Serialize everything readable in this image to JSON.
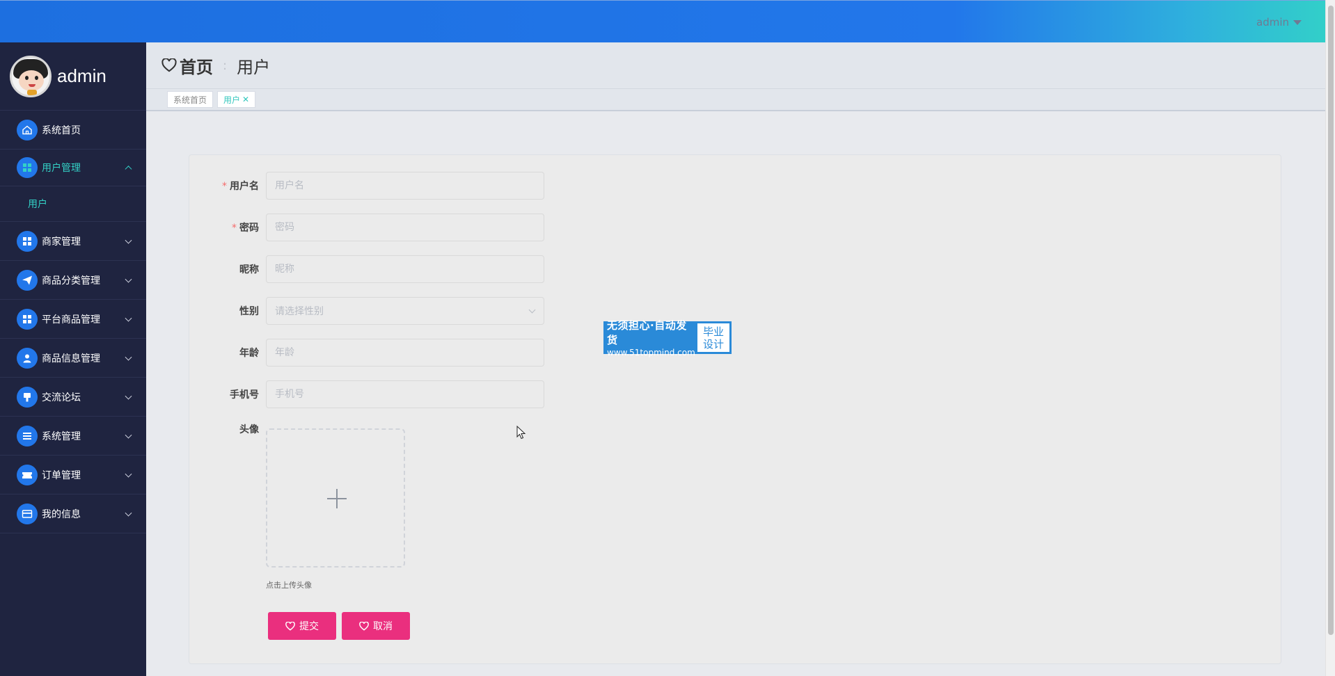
{
  "topbar": {
    "user": "admin"
  },
  "sidebar": {
    "profile_name": "admin",
    "items": [
      {
        "label": "系统首页",
        "icon": "home-icon"
      },
      {
        "label": "用户管理",
        "icon": "grid-icon",
        "open": true,
        "children": [
          {
            "label": "用户"
          }
        ]
      },
      {
        "label": "商家管理",
        "icon": "grid-icon"
      },
      {
        "label": "商品分类管理",
        "icon": "send-icon"
      },
      {
        "label": "平台商品管理",
        "icon": "grid-icon"
      },
      {
        "label": "商品信息管理",
        "icon": "user-icon"
      },
      {
        "label": "交流论坛",
        "icon": "brush-icon"
      },
      {
        "label": "系统管理",
        "icon": "list-icon"
      },
      {
        "label": "订单管理",
        "icon": "ticket-icon"
      },
      {
        "label": "我的信息",
        "icon": "card-icon"
      }
    ]
  },
  "breadcrumb": {
    "home": "首页",
    "current": "用户"
  },
  "tags": [
    {
      "label": "系统首页"
    },
    {
      "label": "用户",
      "closable": true
    }
  ],
  "form": {
    "username": {
      "label": "用户名",
      "placeholder": "用户名",
      "required": true
    },
    "password": {
      "label": "密码",
      "placeholder": "密码",
      "required": true
    },
    "nickname": {
      "label": "昵称",
      "placeholder": "昵称"
    },
    "gender": {
      "label": "性别",
      "placeholder": "请选择性别"
    },
    "age": {
      "label": "年龄",
      "placeholder": "年龄"
    },
    "phone": {
      "label": "手机号",
      "placeholder": "手机号"
    },
    "avatar": {
      "label": "头像",
      "tip": "点击上传头像"
    },
    "submit_label": "提交",
    "cancel_label": "取消"
  },
  "watermark": {
    "line1": "无须担心·自动发货",
    "line2": "www.51topmind.com",
    "right_line1": "毕业",
    "right_line2": "设计"
  },
  "colors": {
    "accent": "#2277ea",
    "sidebar_bg": "#1f2440",
    "active_teal": "#33d1c6",
    "button_pink": "#ea2f7e"
  }
}
